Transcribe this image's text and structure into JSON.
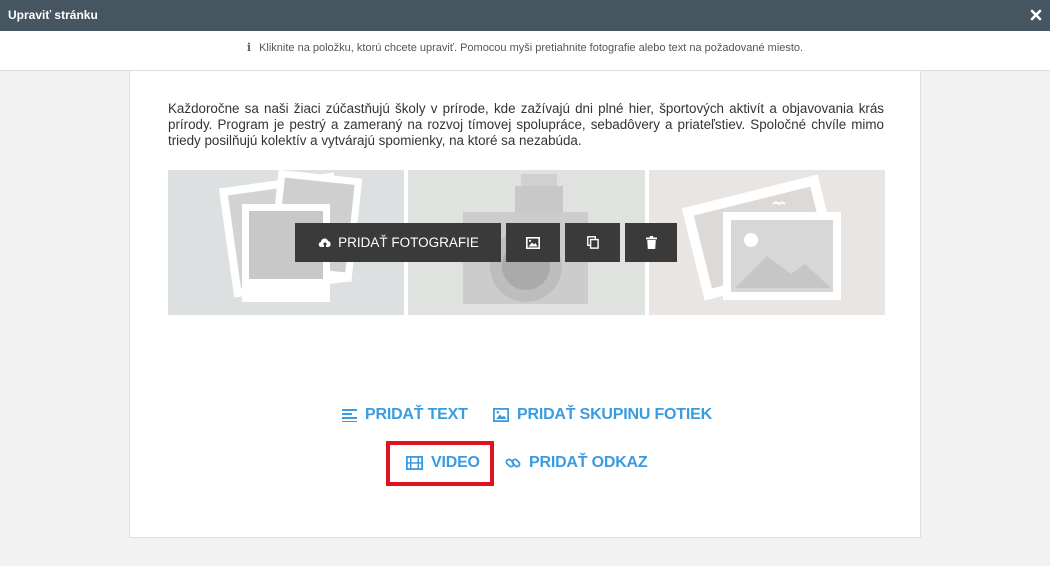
{
  "window": {
    "title": "Upraviť stránku"
  },
  "info": {
    "text": "Kliknite na položku, ktorú chcete upraviť. Pomocou myši pretiahnite fotografie alebo text na požadované miesto."
  },
  "content": {
    "paragraph": "Každoročne sa naši žiaci zúčastňujú školy v prírode, kde zažívajú dni plné hier, športových aktivít a objavovania krás prírody. Program je pestrý a zameraný na rozvoj tímovej spolupráce, sebadôvery a priateľstiev. Spoločné chvíle mimo triedy posilňujú kolektív a vytvárajú spomienky, na ktoré sa nezabúda."
  },
  "toolbar": {
    "add_photos_label": "PRIDAŤ FOTOGRAFIE"
  },
  "actions": {
    "add_text": "PRIDAŤ TEXT",
    "add_photo_group": "PRIDAŤ SKUPINU FOTIEK",
    "video": "VIDEO",
    "add_link": "PRIDAŤ ODKAZ"
  },
  "colors": {
    "titlebar": "#465660",
    "accent": "#3b9be0",
    "highlight": "#e3131b",
    "toolbar_button": "#3a3a3a"
  }
}
